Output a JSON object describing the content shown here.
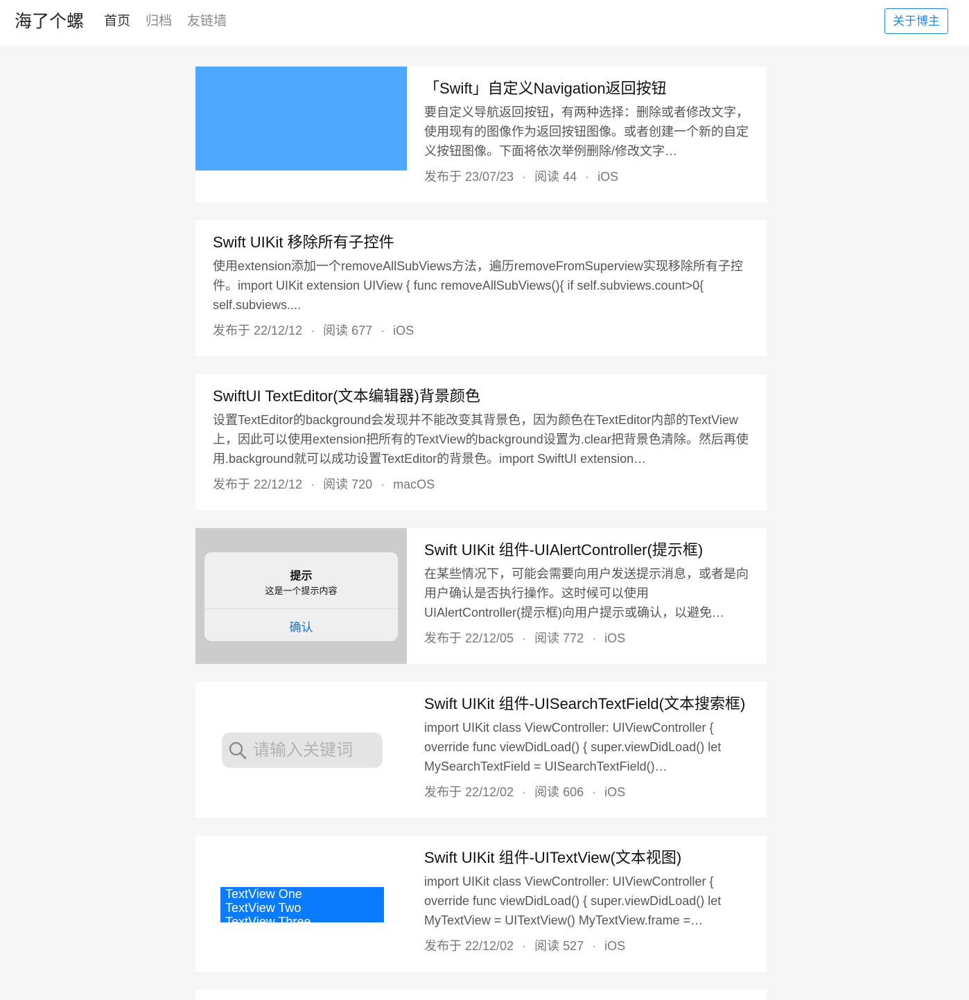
{
  "header": {
    "brand": "海了个螺",
    "nav": [
      {
        "label": "首页"
      },
      {
        "label": "归档"
      },
      {
        "label": "友链墙"
      }
    ],
    "about_button": "关于博主"
  },
  "posts": [
    {
      "title": "「Swift」自定义Navigation返回按钮",
      "excerpt": "要自定义导航返回按钮，有两种选择：删除或者修改文字，使用现有的图像作为返回按钮图像。或者创建一个新的自定义按钮图像。下面将依次举例删除/修改文字…",
      "date": "发布于 23/07/23",
      "reads": "阅读 44",
      "category": "iOS",
      "thumbnail": "blue-image"
    },
    {
      "title": "Swift UIKit 移除所有子控件",
      "excerpt": "使用extension添加一个removeAllSubViews方法，遍历removeFromSuperview实现移除所有子控件。import UIKit extension UIView { func removeAllSubViews(){ if self.subviews.count>0{ self.subviews....",
      "date": "发布于 22/12/12",
      "reads": "阅读 677",
      "category": "iOS"
    },
    {
      "title": "SwiftUI TextEditor(文本编辑器)背景颜色",
      "excerpt": "设置TextEditor的background会发现并不能改变其背景色，因为颜色在TextEditor内部的TextView上，因此可以使用extension把所有的TextView的background设置为.clear把背景色清除。然后再使用.background就可以成功设置TextEditor的背景色。import SwiftUI extension…",
      "date": "发布于 22/12/12",
      "reads": "阅读 720",
      "category": "macOS"
    },
    {
      "title": "Swift UIKit 组件-UIAlertController(提示框)",
      "excerpt": "在某些情况下，可能会需要向用户发送提示消息，或者是向用户确认是否执行操作。这时候可以使用UIAlertController(提示框)向用户提示或确认，以避免…",
      "date": "发布于 22/12/05",
      "reads": "阅读 772",
      "category": "iOS",
      "thumbnail": "alert-preview",
      "thumb_alert": {
        "title": "提示",
        "message": "这是一个提示内容",
        "button": "确认"
      }
    },
    {
      "title": "Swift UIKit 组件-UISearchTextField(文本搜索框)",
      "excerpt": "import UIKit class ViewController: UIViewController { override func viewDidLoad() { super.viewDidLoad() let MySearchTextField = UISearchTextField()…",
      "date": "发布于 22/12/02",
      "reads": "阅读 606",
      "category": "iOS",
      "thumbnail": "search-preview",
      "thumb_search": {
        "placeholder": "请输入关键词",
        "icon": "search-icon"
      }
    },
    {
      "title": "Swift UIKit 组件-UITextView(文本视图)",
      "excerpt": "import UIKit class ViewController: UIViewController { override func viewDidLoad() { super.viewDidLoad() let MyTextView = UITextView() MyTextView.frame =…",
      "date": "发布于 22/12/02",
      "reads": "阅读 527",
      "category": "iOS",
      "thumbnail": "textview-preview",
      "thumb_textview": {
        "lines": [
          "TextView One",
          "TextView Two",
          "TextView Three"
        ]
      }
    }
  ],
  "colors": {
    "accent": "#1e88e5",
    "page_bg": "#f5f5f5",
    "thumb_blue": "#4fa8ff",
    "textview_blue": "#0a7aff"
  }
}
